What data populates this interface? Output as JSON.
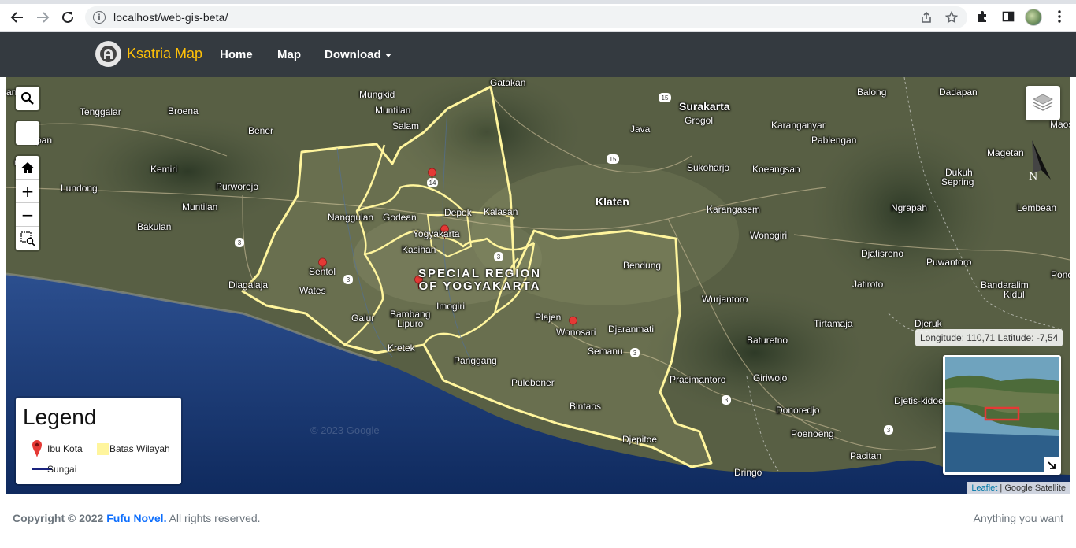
{
  "browser": {
    "url": "localhost/web-gis-beta/",
    "icons": [
      "back-icon",
      "forward-icon",
      "reload-icon",
      "info-icon",
      "share-icon",
      "star-icon",
      "extensions-icon",
      "sidepanel-icon",
      "profile-avatar",
      "menu-icon"
    ]
  },
  "navbar": {
    "brand": "Ksatria Map",
    "links": [
      "Home",
      "Map"
    ],
    "dropdown": "Download",
    "colors": {
      "background": "#343a40",
      "brand": "#ffc107"
    }
  },
  "map": {
    "region_label": [
      "SPECIAL REGION",
      "OF YOGYAKARTA"
    ],
    "watermark": "© 2023 Google",
    "coords": "Longitude: 110,71 Latitude: -7,54",
    "attribution": {
      "link": "Leaflet",
      "source": "Google Satellite"
    },
    "north_label": "N",
    "boundary_color": "#fff59d",
    "places": [
      {
        "text": "anioro"
      },
      {
        "text": "Tenggalar"
      },
      {
        "text": "Broena"
      },
      {
        "text": "Bener"
      },
      {
        "text": "Mungkid"
      },
      {
        "text": "Muntilan"
      },
      {
        "text": "Salam"
      },
      {
        "text": "Gatakan"
      },
      {
        "text": "Surakarta"
      },
      {
        "text": "Grogol"
      },
      {
        "text": "Java"
      },
      {
        "text": "Balong"
      },
      {
        "text": "Dadapan"
      },
      {
        "text": "Karanganyar"
      },
      {
        "text": "Pablengan"
      },
      {
        "text": "Maosp"
      },
      {
        "text": "Magetan"
      },
      {
        "text": "Dukuh"
      },
      {
        "text": "Sepring"
      },
      {
        "text": "Sukoharjo"
      },
      {
        "text": "Koeangsan"
      },
      {
        "text": "Klaten"
      },
      {
        "text": "Karangasem"
      },
      {
        "text": "Ngrapah"
      },
      {
        "text": "Lembean"
      },
      {
        "text": "Wonogiri"
      },
      {
        "text": "pan"
      },
      {
        "text": "men"
      },
      {
        "text": "Kemiri"
      },
      {
        "text": "Purworejo"
      },
      {
        "text": "Lundong"
      },
      {
        "text": "Muntilan"
      },
      {
        "text": "Bakulan"
      },
      {
        "text": "Nanggulan"
      },
      {
        "text": "Godean"
      },
      {
        "text": "Depok"
      },
      {
        "text": "Kalasan"
      },
      {
        "text": "Yogyakarta"
      },
      {
        "text": "Kasihan"
      },
      {
        "text": "Sentol"
      },
      {
        "text": "Diagalaja"
      },
      {
        "text": "Wates"
      },
      {
        "text": "Galur"
      },
      {
        "text": "Bambang"
      },
      {
        "text": "Lipuro"
      },
      {
        "text": "Imogiri"
      },
      {
        "text": "Kretek"
      },
      {
        "text": "Bendung"
      },
      {
        "text": "Djatisrono"
      },
      {
        "text": "Puwantoro"
      },
      {
        "text": "Jatiroto"
      },
      {
        "text": "Bandaralim"
      },
      {
        "text": "Kidul"
      },
      {
        "text": "Ponc"
      },
      {
        "text": "Wurjantoro"
      },
      {
        "text": "Plajen"
      },
      {
        "text": "Wonosari"
      },
      {
        "text": "Djaranmati"
      },
      {
        "text": "Tirtamaja"
      },
      {
        "text": "Djeruk"
      },
      {
        "text": "Baturetno"
      },
      {
        "text": "Semanu"
      },
      {
        "text": "Panggang"
      },
      {
        "text": "Pulebener"
      },
      {
        "text": "Pracimantoro"
      },
      {
        "text": "Giriwojo"
      },
      {
        "text": "Djetis-kidoe"
      },
      {
        "text": "Bintaos"
      },
      {
        "text": "Donoredjo"
      },
      {
        "text": "Poenoeng"
      },
      {
        "text": "Djepitoe"
      },
      {
        "text": "Pacitan"
      },
      {
        "text": "Dringo"
      }
    ],
    "road_shields": [
      "15",
      "15",
      "3",
      "3",
      "3",
      "3",
      "3",
      "3",
      "14"
    ]
  },
  "controls": {
    "icons": [
      "search-icon",
      "home-icon",
      "zoom-in-icon",
      "zoom-out-icon",
      "box-zoom-icon",
      "layers-icon"
    ],
    "zoom_in": "+",
    "zoom_out": "−"
  },
  "legend": {
    "title": "Legend",
    "items": [
      {
        "label": "Ibu Kota",
        "symbol": "red-marker-icon",
        "color": "#e53935"
      },
      {
        "label": "Batas Wilayah",
        "symbol": "boundary-swatch",
        "color": "#fff59d"
      },
      {
        "label": "Sungai",
        "symbol": "river-line",
        "color": "#1a237e"
      }
    ]
  },
  "footer": {
    "copyright": "Copyright © 2022",
    "brand": "Fufu Novel.",
    "rights": "All rights reserved.",
    "tagline": "Anything you want"
  }
}
